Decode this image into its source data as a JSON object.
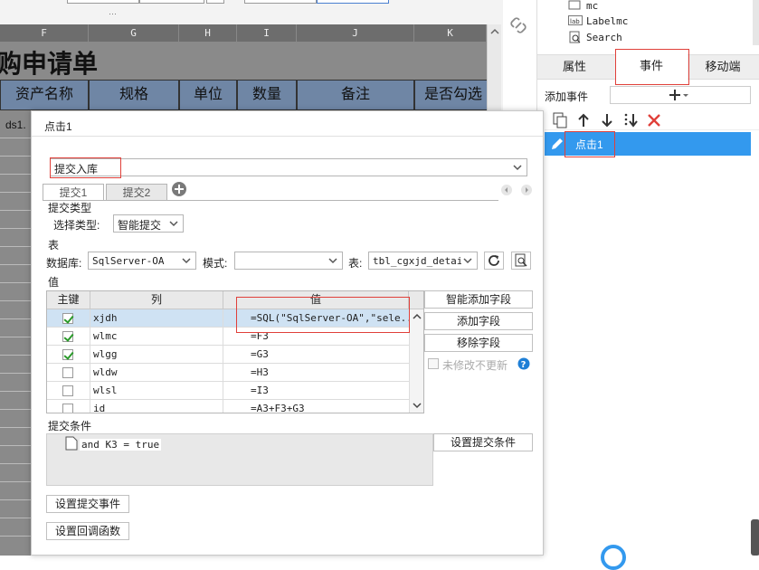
{
  "spreadsheet": {
    "columns": [
      "F",
      "G",
      "H",
      "I",
      "J",
      "K"
    ],
    "title": "购申请单",
    "headers": [
      "资产名称",
      "规格",
      "单位",
      "数量",
      "备注",
      "是否勾选"
    ],
    "row_label": "ds1."
  },
  "right_panel": {
    "tree": [
      "mc",
      "Labelmc",
      "Search"
    ],
    "tabs": [
      "属性",
      "事件",
      "移动端"
    ],
    "add_event_label": "添加事件",
    "event_item": "点击1"
  },
  "dialog": {
    "title": "点击1",
    "event_name": "提交入库",
    "tabs": [
      "提交1",
      "提交2"
    ],
    "submit_type_section": "提交类型",
    "select_type_label": "选择类型:",
    "select_type_value": "智能提交",
    "table_section": "表",
    "database_label": "数据库:",
    "database_value": "SqlServer-OA",
    "schema_label": "模式:",
    "schema_value": "",
    "table_label": "表:",
    "table_value": "tbl_cgxjd_detail",
    "value_section": "值",
    "grid_headers": [
      "主键",
      "列",
      "值"
    ],
    "rows": [
      {
        "key": true,
        "column": "xjdh",
        "value": "=SQL(\"SqlServer-OA\",\"sele..."
      },
      {
        "key": true,
        "column": "wlmc",
        "value": "=F3"
      },
      {
        "key": true,
        "column": "wlgg",
        "value": "=G3"
      },
      {
        "key": false,
        "column": "wldw",
        "value": "=H3"
      },
      {
        "key": false,
        "column": "wlsl",
        "value": "=I3"
      },
      {
        "key": false,
        "column": "id",
        "value": "=A3+F3+G3"
      }
    ],
    "buttons": {
      "smart_add": "智能添加字段",
      "add_field": "添加字段",
      "remove_field": "移除字段",
      "no_update_unmodified": "未修改不更新",
      "set_condition": "设置提交条件",
      "set_submit_event": "设置提交事件",
      "set_callback": "设置回调函数"
    },
    "condition_section": "提交条件",
    "condition_text": "and K3 = true"
  },
  "colors": {
    "accent": "#3399ee",
    "highlight_red": "#e0403a",
    "header_blue": "#6f86a5"
  }
}
